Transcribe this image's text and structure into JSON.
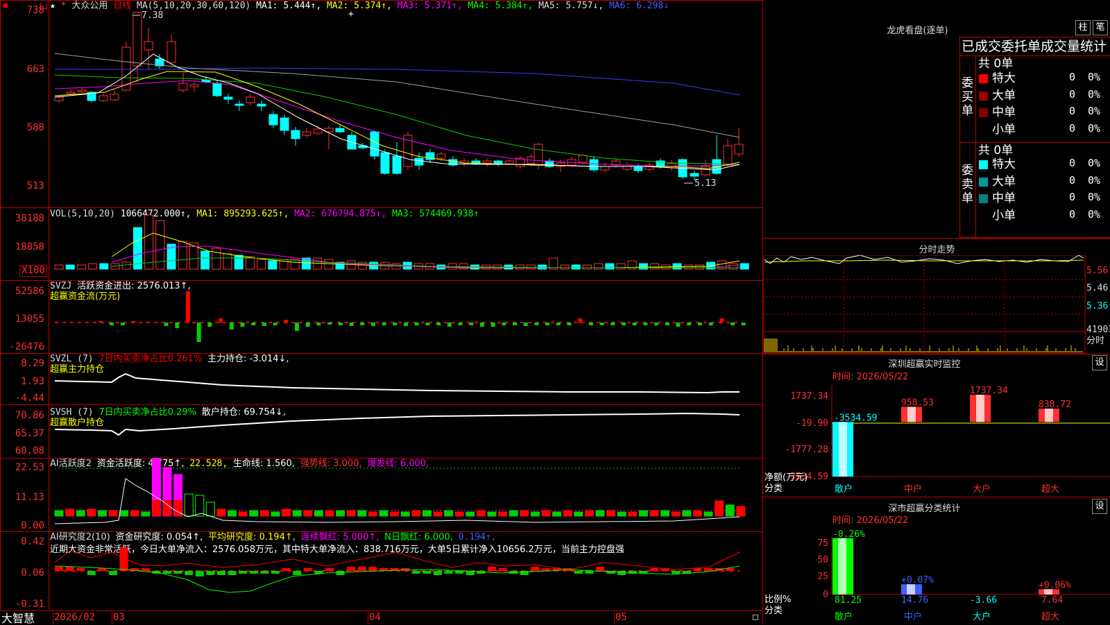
{
  "stock": {
    "name": "大众公用",
    "period": "日线",
    "ma_label": "MA(5,10,20,30,60,120)",
    "ma1": "MA1: 5.444↑,",
    "ma2": "MA2: 5.374↑,",
    "ma3": "MA3: 5.371↑,",
    "ma4": "MA4: 5.384↑,",
    "ma5": "MA5: 5.757↓,",
    "ma6": "MA6: 6.298↓",
    "high_mark": "7.38",
    "low_mark": "5.13",
    "price_axis": [
      "738",
      "663",
      "588",
      "513"
    ]
  },
  "vol": {
    "label": "VOL(5,10,20)",
    "value": "1066472.000↑,",
    "ma1": "MA1: 895293.625↑,",
    "ma2": "MA2: 676794.875↑,",
    "ma3": "MA3: 574469.938↑",
    "axis": [
      "38188",
      "18858",
      "X100"
    ]
  },
  "svzj": {
    "label": "SVZJ",
    "desc": "活跃资金进出: 2576.013↑,",
    "sub": "超赢资金流(万元)",
    "axis": [
      "52586",
      "13055",
      "-26476"
    ]
  },
  "svzl": {
    "label": "SVZL (7)",
    "desc1": "7日内买卖净占比0.261%",
    "desc2": "主力持仓: -3.014↓,",
    "sub": "超赢主力持仓",
    "axis": [
      "8.29",
      "1.93",
      "-4.44"
    ]
  },
  "svsh": {
    "label": "SVSH (7)",
    "desc1": "7日内买卖净占比0.29%",
    "desc2": "散户持仓: 69.754↓,",
    "sub": "超赢散户持仓",
    "axis": [
      "70.86",
      "65.37",
      "60.08"
    ]
  },
  "ai1": {
    "label": "AI活跃度2",
    "p1": "资金活跃度: 4.775↑,",
    "p2": "22.528,",
    "p3": "生命线: 1.560,",
    "p4": "强势线: 3.000,",
    "p5": "爆发线: 6.000,",
    "axis": [
      "22.53",
      "11.13",
      "0.00"
    ]
  },
  "ai2": {
    "label": "AI研究度2(10)",
    "p1": "资金研究度: 0.054↑,",
    "p2": "平均研究度: 0.194↑,",
    "p3": "连续飘红: 5.000↑,",
    "p4": "N日飘红: 6.000,",
    "p5": "0.194↑,",
    "summary": "近期大资金非常活跃，今日大单净流入：2576.058万元，其中特大单净流入：838.716万元，大单5日累计净入10656.2万元，当前主力控盘强",
    "axis": [
      "0.42",
      "0.06",
      "-0.31"
    ]
  },
  "footer": {
    "brand": "大智慧",
    "dates": [
      "2026/02",
      "03",
      "04",
      "05"
    ]
  },
  "lhb": {
    "title": "龙虎看盘(逐单)",
    "btn1": "柱",
    "btn2": "笔",
    "header": "已成交委托单成交量统计",
    "buy_label": "委买单",
    "sell_label": "委卖单",
    "buy_total": "共 0单",
    "sell_total": "共 0单",
    "buy_rows": [
      {
        "name": "特大",
        "count": "0",
        "pct": "0%"
      },
      {
        "name": "大单",
        "count": "0",
        "pct": "0%"
      },
      {
        "name": "中单",
        "count": "0",
        "pct": "0%"
      },
      {
        "name": "小单",
        "count": "0",
        "pct": "0%"
      }
    ],
    "sell_rows": [
      {
        "name": "特大",
        "count": "0",
        "pct": "0%"
      },
      {
        "name": "大单",
        "count": "0",
        "pct": "0%"
      },
      {
        "name": "中单",
        "count": "0",
        "pct": "0%"
      },
      {
        "name": "小单",
        "count": "0",
        "pct": "0%"
      }
    ],
    "buy_colors": [
      "#ff0000",
      "#990000",
      "#800000",
      "#000000"
    ],
    "sell_colors": [
      "#00ffff",
      "#009999",
      "#008080",
      "#000000"
    ]
  },
  "intraday": {
    "title": "分时走势",
    "axis": [
      "5.56",
      "5.46",
      "5.36",
      "41903",
      "分时"
    ]
  },
  "monitor": {
    "title": "深圳超赢实时监控",
    "btn": "设",
    "time": "时间: 2026/05/22",
    "axis": [
      "1737.34",
      "-19.90",
      "-1777.28",
      "-3534.59"
    ],
    "unit": "净额(万元)",
    "cat_label": "分类",
    "categories": [
      "散户",
      "中户",
      "大户",
      "超大"
    ],
    "values": [
      "-3534.59",
      "958.53",
      "1737.34",
      "838.72"
    ]
  },
  "classify": {
    "title": "深市超赢分类统计",
    "btn": "设",
    "time": "时间: 2026/05/22",
    "axis": [
      "75",
      "50",
      "25",
      "0"
    ],
    "unit": "比例%",
    "cat_label": "分类",
    "categories": [
      "散户",
      "中户",
      "大户",
      "超大"
    ],
    "top_labels": [
      "-0.26%",
      "+0.07%",
      "",
      "+0.06%"
    ],
    "values": [
      "81.25",
      "14.76",
      "-3.66",
      "7.64"
    ]
  }
}
